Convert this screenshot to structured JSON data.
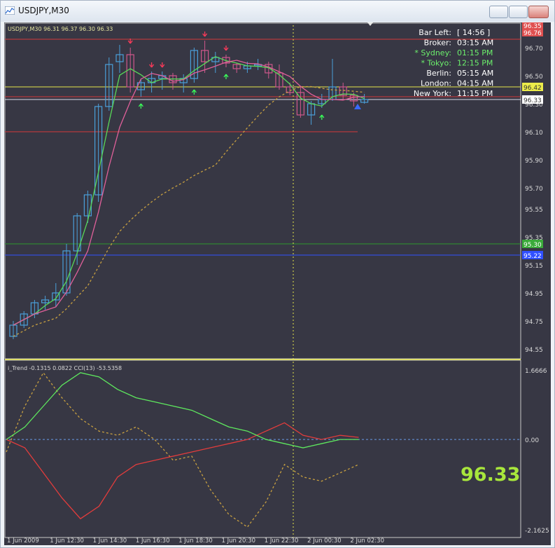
{
  "window": {
    "title": "USDJPY,M30",
    "min_label": "—",
    "max_label": "□",
    "close_label": "✕"
  },
  "colors": {
    "background": "#373744",
    "bull": "#4a9fd9",
    "bear": "#d0588c",
    "green_line": "#4fdc5a",
    "red_line": "#e23c3c",
    "yellow": "#e6e64a",
    "orange_dash": "#c8a040",
    "blue_line": "#3050ff",
    "big_price": "#a8e63c"
  },
  "main_chart": {
    "info_label": "USDJPY,M30  96.31 96.37 96.30 96.33",
    "price_axis": [
      "96.70",
      "96.50",
      "96.30",
      "96.10",
      "95.90",
      "95.70",
      "95.55",
      "95.35",
      "95.15",
      "94.95",
      "94.75",
      "94.55"
    ],
    "price_tags": [
      {
        "text": "96.42",
        "bg": "#ecec4a",
        "fg": "#333333"
      },
      {
        "text": "96.33",
        "bg": "#ffffff",
        "fg": "#333333"
      },
      {
        "text": "96.35",
        "bg": "#e05050",
        "fg": "#ffffff"
      },
      {
        "text": "96.76",
        "bg": "#e05050",
        "fg": "#ffffff"
      },
      {
        "text": "95.22",
        "bg": "#3050ff",
        "fg": "#ffffff"
      },
      {
        "text": "95.30",
        "bg": "#3aaa3a",
        "fg": "#ffffff"
      }
    ]
  },
  "session_panel": [
    {
      "label": "Bar Left:",
      "value": "[ 14:56 ]",
      "color": "#ffffff"
    },
    {
      "label": "Broker:",
      "value": "03:15 AM",
      "color": "#ffffff"
    },
    {
      "label": "* Sydney:",
      "value": "01:15 PM",
      "color": "#6cf06c"
    },
    {
      "label": "* Tokyo:",
      "value": "12:15 PM",
      "color": "#6cf06c"
    },
    {
      "label": "Berlin:",
      "value": "05:15 AM",
      "color": "#ffffff"
    },
    {
      "label": "London:",
      "value": "04:15 AM",
      "color": "#ffffff"
    },
    {
      "label": "New York:",
      "value": "11:15 PM",
      "color": "#ffffff"
    }
  ],
  "indicator": {
    "label": "i_Trend -0.1315 0.0822  CCI(13) -53.5358",
    "axis": [
      "1.6666",
      "0.00",
      "-2.1625"
    ],
    "big_price": "96.33"
  },
  "time_axis": [
    "1 Jun 2009",
    "1 Jun 12:30",
    "1 Jun 14:30",
    "1 Jun 16:30",
    "1 Jun 18:30",
    "1 Jun 20:30",
    "1 Jun 22:30",
    "2 Jun 00:30",
    "2 Jun 02:30"
  ],
  "chart_data": {
    "type": "candlestick",
    "symbol": "USDJPY",
    "timeframe": "M30",
    "ohlc": [
      [
        94.64,
        94.75,
        94.62,
        94.72
      ],
      [
        94.72,
        94.82,
        94.7,
        94.8
      ],
      [
        94.8,
        94.9,
        94.77,
        94.88
      ],
      [
        94.88,
        94.93,
        94.83,
        94.9
      ],
      [
        94.9,
        95.02,
        94.85,
        94.95
      ],
      [
        94.95,
        95.3,
        94.93,
        95.25
      ],
      [
        95.25,
        95.52,
        95.15,
        95.5
      ],
      [
        95.5,
        95.68,
        95.45,
        95.65
      ],
      [
        95.65,
        96.3,
        95.6,
        96.28
      ],
      [
        96.28,
        96.63,
        96.25,
        96.58
      ],
      [
        96.6,
        96.72,
        96.52,
        96.65
      ],
      [
        96.65,
        96.7,
        96.38,
        96.42
      ],
      [
        96.4,
        96.48,
        96.35,
        96.45
      ],
      [
        96.45,
        96.53,
        96.38,
        96.48
      ],
      [
        96.48,
        96.53,
        96.4,
        96.5
      ],
      [
        96.5,
        96.52,
        96.4,
        96.45
      ],
      [
        96.45,
        96.51,
        96.38,
        96.48
      ],
      [
        96.48,
        96.7,
        96.45,
        96.68
      ],
      [
        96.68,
        96.75,
        96.52,
        96.6
      ],
      [
        96.6,
        96.67,
        96.52,
        96.63
      ],
      [
        96.63,
        96.65,
        96.56,
        96.59
      ],
      [
        96.58,
        96.59,
        96.52,
        96.55
      ],
      [
        96.55,
        96.6,
        96.52,
        96.57
      ],
      [
        96.57,
        96.62,
        96.54,
        96.58
      ],
      [
        96.58,
        96.6,
        96.48,
        96.52
      ],
      [
        96.52,
        96.58,
        96.4,
        96.42
      ],
      [
        96.42,
        96.45,
        96.36,
        96.38
      ],
      [
        96.38,
        96.42,
        96.2,
        96.22
      ],
      [
        96.22,
        96.32,
        96.15,
        96.3
      ],
      [
        96.3,
        96.37,
        96.27,
        96.33
      ],
      [
        96.33,
        96.62,
        96.32,
        96.42
      ],
      [
        96.42,
        96.45,
        96.33,
        96.36
      ],
      [
        96.36,
        96.38,
        96.28,
        96.32
      ],
      [
        96.31,
        96.37,
        96.3,
        96.33
      ]
    ],
    "horizontal_lines": [
      {
        "price": 96.42,
        "color": "yellow"
      },
      {
        "price": 96.33,
        "color": "white"
      },
      {
        "price": 96.35,
        "color": "red"
      },
      {
        "price": 96.76,
        "color": "red"
      },
      {
        "price": 96.1,
        "color": "red"
      },
      {
        "price": 95.22,
        "color": "blue"
      },
      {
        "price": 95.3,
        "color": "green"
      }
    ],
    "indicator_series": [
      {
        "values": [
          0.0,
          0.3,
          0.8,
          1.3,
          1.6,
          1.5,
          1.2,
          1.0,
          0.9,
          0.8,
          0.7,
          0.5,
          0.3,
          0.2,
          0.0,
          -0.1,
          -0.2,
          -0.1,
          0.0,
          0.0
        ]
      },
      {
        "values": [
          0.0,
          -0.2,
          -0.8,
          -1.4,
          -1.9,
          -1.6,
          -0.9,
          -0.6,
          -0.5,
          -0.4,
          -0.3,
          -0.2,
          -0.1,
          0.0,
          0.2,
          0.4,
          0.1,
          0.0,
          0.1,
          0.05
        ]
      },
      {
        "values": [
          -0.3,
          0.8,
          1.6,
          1.0,
          0.5,
          0.2,
          0.1,
          0.3,
          0.0,
          -0.5,
          -0.4,
          -1.2,
          -1.8,
          -2.1,
          -1.5,
          -0.6,
          -0.9,
          -1.0,
          -0.8,
          -0.6
        ]
      }
    ]
  }
}
